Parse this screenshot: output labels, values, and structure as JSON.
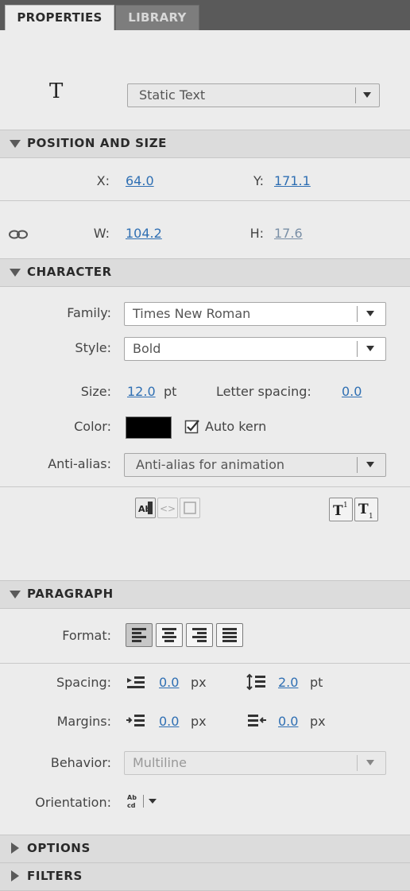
{
  "tabs": {
    "properties": "PROPERTIES",
    "library": "LIBRARY"
  },
  "tool": {
    "glyph": "T",
    "text_type": "Static Text"
  },
  "position_size": {
    "header": "POSITION AND SIZE",
    "x_label": "X:",
    "x_value": "64.0",
    "y_label": "Y:",
    "y_value": "171.1",
    "w_label": "W:",
    "w_value": "104.2",
    "h_label": "H:",
    "h_value": "17.6"
  },
  "character": {
    "header": "CHARACTER",
    "family_label": "Family:",
    "family_value": "Times New Roman",
    "style_label": "Style:",
    "style_value": "Bold",
    "size_label": "Size:",
    "size_value": "12.0",
    "size_unit": "pt",
    "letter_spacing_label": "Letter spacing:",
    "letter_spacing_value": "0.0",
    "color_label": "Color:",
    "color_value": "#000000",
    "auto_kern_label": "Auto kern",
    "auto_kern_checked": true,
    "anti_alias_label": "Anti-alias:",
    "anti_alias_value": "Anti-alias for animation"
  },
  "paragraph": {
    "header": "PARAGRAPH",
    "format_label": "Format:",
    "spacing_label": "Spacing:",
    "spacing_indent_value": "0.0",
    "spacing_indent_unit": "px",
    "spacing_line_value": "2.0",
    "spacing_line_unit": "pt",
    "margins_label": "Margins:",
    "margin_left_value": "0.0",
    "margin_left_unit": "px",
    "margin_right_value": "0.0",
    "margin_right_unit": "px",
    "behavior_label": "Behavior:",
    "behavior_value": "Multiline",
    "orientation_label": "Orientation:"
  },
  "options": {
    "header": "OPTIONS"
  },
  "filters": {
    "header": "FILTERS"
  }
}
